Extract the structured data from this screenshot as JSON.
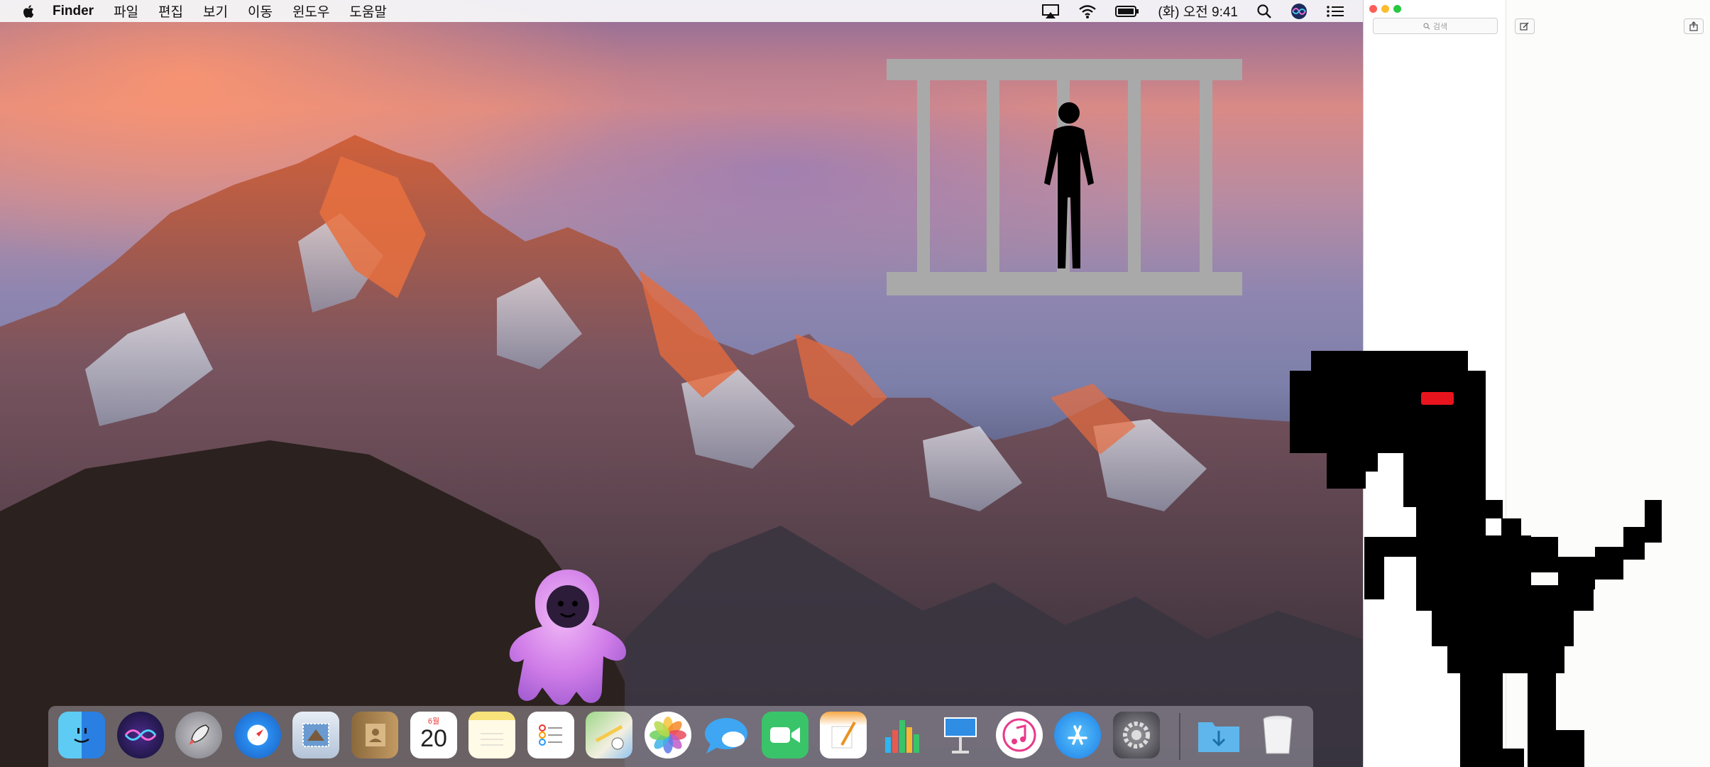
{
  "menubar": {
    "app_name": "Finder",
    "menus": [
      "파일",
      "편집",
      "보기",
      "이동",
      "윈도우",
      "도움말"
    ],
    "clock": "(화) 오전 9:41"
  },
  "notes_window": {
    "search_placeholder": "검색"
  },
  "dock": {
    "items": [
      "Finder",
      "Siri",
      "Launchpad",
      "Safari",
      "Mail",
      "Contacts",
      "Calendar",
      "Notes",
      "Reminders",
      "Maps",
      "Photos",
      "Messages",
      "FaceTime",
      "Pages",
      "Numbers",
      "Keynote",
      "iTunes",
      "App Store",
      "System Preferences",
      "Downloads",
      "Trash"
    ],
    "calendar_month": "6월",
    "calendar_day": "20"
  },
  "colors": {
    "menubar_bg": "#f5f5f7",
    "close": "#fc5f57",
    "minimize": "#fdbc2e",
    "zoom": "#28c840",
    "cage": "#a9a9a9",
    "dino": "#000000",
    "dino_eye": "#e8141d",
    "ghost": "#d07de8"
  }
}
